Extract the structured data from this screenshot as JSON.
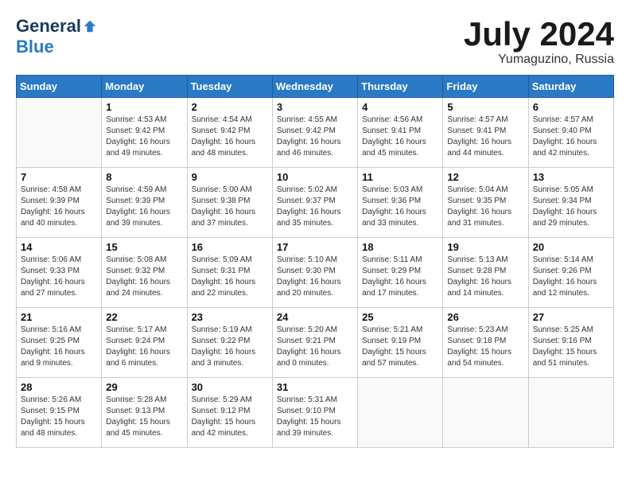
{
  "logo": {
    "general": "General",
    "blue": "Blue"
  },
  "title": "July 2024",
  "location": "Yumaguzino, Russia",
  "days_of_week": [
    "Sunday",
    "Monday",
    "Tuesday",
    "Wednesday",
    "Thursday",
    "Friday",
    "Saturday"
  ],
  "weeks": [
    [
      {
        "day": "",
        "info": ""
      },
      {
        "day": "1",
        "info": "Sunrise: 4:53 AM\nSunset: 9:42 PM\nDaylight: 16 hours\nand 49 minutes."
      },
      {
        "day": "2",
        "info": "Sunrise: 4:54 AM\nSunset: 9:42 PM\nDaylight: 16 hours\nand 48 minutes."
      },
      {
        "day": "3",
        "info": "Sunrise: 4:55 AM\nSunset: 9:42 PM\nDaylight: 16 hours\nand 46 minutes."
      },
      {
        "day": "4",
        "info": "Sunrise: 4:56 AM\nSunset: 9:41 PM\nDaylight: 16 hours\nand 45 minutes."
      },
      {
        "day": "5",
        "info": "Sunrise: 4:57 AM\nSunset: 9:41 PM\nDaylight: 16 hours\nand 44 minutes."
      },
      {
        "day": "6",
        "info": "Sunrise: 4:57 AM\nSunset: 9:40 PM\nDaylight: 16 hours\nand 42 minutes."
      }
    ],
    [
      {
        "day": "7",
        "info": "Sunrise: 4:58 AM\nSunset: 9:39 PM\nDaylight: 16 hours\nand 40 minutes."
      },
      {
        "day": "8",
        "info": "Sunrise: 4:59 AM\nSunset: 9:39 PM\nDaylight: 16 hours\nand 39 minutes."
      },
      {
        "day": "9",
        "info": "Sunrise: 5:00 AM\nSunset: 9:38 PM\nDaylight: 16 hours\nand 37 minutes."
      },
      {
        "day": "10",
        "info": "Sunrise: 5:02 AM\nSunset: 9:37 PM\nDaylight: 16 hours\nand 35 minutes."
      },
      {
        "day": "11",
        "info": "Sunrise: 5:03 AM\nSunset: 9:36 PM\nDaylight: 16 hours\nand 33 minutes."
      },
      {
        "day": "12",
        "info": "Sunrise: 5:04 AM\nSunset: 9:35 PM\nDaylight: 16 hours\nand 31 minutes."
      },
      {
        "day": "13",
        "info": "Sunrise: 5:05 AM\nSunset: 9:34 PM\nDaylight: 16 hours\nand 29 minutes."
      }
    ],
    [
      {
        "day": "14",
        "info": "Sunrise: 5:06 AM\nSunset: 9:33 PM\nDaylight: 16 hours\nand 27 minutes."
      },
      {
        "day": "15",
        "info": "Sunrise: 5:08 AM\nSunset: 9:32 PM\nDaylight: 16 hours\nand 24 minutes."
      },
      {
        "day": "16",
        "info": "Sunrise: 5:09 AM\nSunset: 9:31 PM\nDaylight: 16 hours\nand 22 minutes."
      },
      {
        "day": "17",
        "info": "Sunrise: 5:10 AM\nSunset: 9:30 PM\nDaylight: 16 hours\nand 20 minutes."
      },
      {
        "day": "18",
        "info": "Sunrise: 5:11 AM\nSunset: 9:29 PM\nDaylight: 16 hours\nand 17 minutes."
      },
      {
        "day": "19",
        "info": "Sunrise: 5:13 AM\nSunset: 9:28 PM\nDaylight: 16 hours\nand 14 minutes."
      },
      {
        "day": "20",
        "info": "Sunrise: 5:14 AM\nSunset: 9:26 PM\nDaylight: 16 hours\nand 12 minutes."
      }
    ],
    [
      {
        "day": "21",
        "info": "Sunrise: 5:16 AM\nSunset: 9:25 PM\nDaylight: 16 hours\nand 9 minutes."
      },
      {
        "day": "22",
        "info": "Sunrise: 5:17 AM\nSunset: 9:24 PM\nDaylight: 16 hours\nand 6 minutes."
      },
      {
        "day": "23",
        "info": "Sunrise: 5:19 AM\nSunset: 9:22 PM\nDaylight: 16 hours\nand 3 minutes."
      },
      {
        "day": "24",
        "info": "Sunrise: 5:20 AM\nSunset: 9:21 PM\nDaylight: 16 hours\nand 0 minutes."
      },
      {
        "day": "25",
        "info": "Sunrise: 5:21 AM\nSunset: 9:19 PM\nDaylight: 15 hours\nand 57 minutes."
      },
      {
        "day": "26",
        "info": "Sunrise: 5:23 AM\nSunset: 9:18 PM\nDaylight: 15 hours\nand 54 minutes."
      },
      {
        "day": "27",
        "info": "Sunrise: 5:25 AM\nSunset: 9:16 PM\nDaylight: 15 hours\nand 51 minutes."
      }
    ],
    [
      {
        "day": "28",
        "info": "Sunrise: 5:26 AM\nSunset: 9:15 PM\nDaylight: 15 hours\nand 48 minutes."
      },
      {
        "day": "29",
        "info": "Sunrise: 5:28 AM\nSunset: 9:13 PM\nDaylight: 15 hours\nand 45 minutes."
      },
      {
        "day": "30",
        "info": "Sunrise: 5:29 AM\nSunset: 9:12 PM\nDaylight: 15 hours\nand 42 minutes."
      },
      {
        "day": "31",
        "info": "Sunrise: 5:31 AM\nSunset: 9:10 PM\nDaylight: 15 hours\nand 39 minutes."
      },
      {
        "day": "",
        "info": ""
      },
      {
        "day": "",
        "info": ""
      },
      {
        "day": "",
        "info": ""
      }
    ]
  ]
}
